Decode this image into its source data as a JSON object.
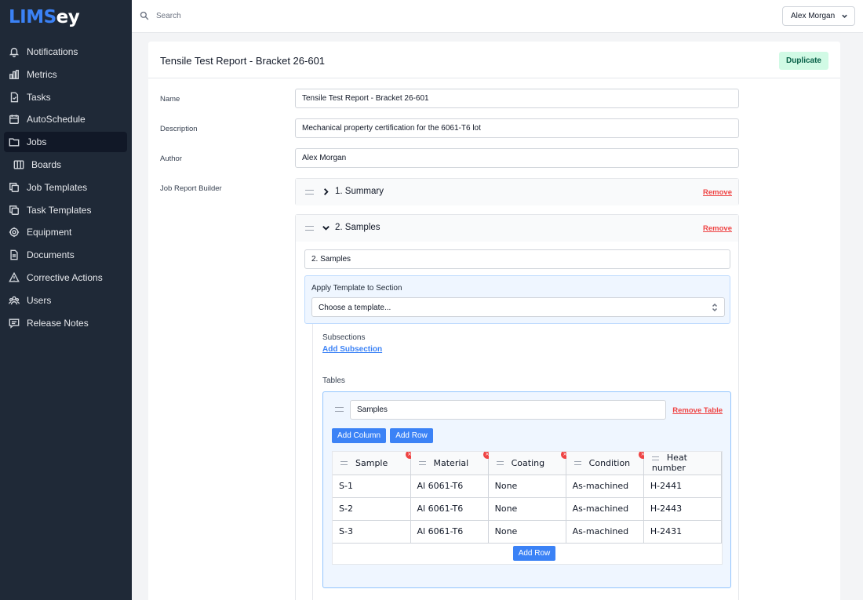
{
  "logo": {
    "part1": "LIMS",
    "part2": "ey"
  },
  "search": {
    "placeholder": "Search"
  },
  "user": {
    "name": "Alex Morgan"
  },
  "sidebar": {
    "items": [
      {
        "label": "Notifications",
        "icon": "bell-icon"
      },
      {
        "label": "Metrics",
        "icon": "bar-chart-icon"
      },
      {
        "label": "Tasks",
        "icon": "clipboard-check-icon"
      },
      {
        "label": "AutoSchedule",
        "icon": "calendar-icon"
      },
      {
        "label": "Jobs",
        "icon": "folder-icon"
      },
      {
        "label": "Boards",
        "icon": "columns-icon"
      },
      {
        "label": "Job Templates",
        "icon": "copy-icon"
      },
      {
        "label": "Task Templates",
        "icon": "copy-icon"
      },
      {
        "label": "Equipment",
        "icon": "gear-icon"
      },
      {
        "label": "Documents",
        "icon": "document-icon"
      },
      {
        "label": "Corrective Actions",
        "icon": "warning-icon"
      },
      {
        "label": "Users",
        "icon": "users-icon"
      },
      {
        "label": "Release Notes",
        "icon": "chat-icon"
      }
    ]
  },
  "header": {
    "title": "Tensile Test Report - Bracket 26-601",
    "duplicate_label": "Duplicate"
  },
  "form": {
    "name_label": "Name",
    "name_value": "Tensile Test Report - Bracket 26-601",
    "description_label": "Description",
    "description_value": "Mechanical property certification for the 6061-T6 lot",
    "author_label": "Author",
    "author_value": "Alex Morgan",
    "builder_label": "Job Report Builder"
  },
  "sections": [
    {
      "title": "1. Summary",
      "remove_label": "Remove"
    },
    {
      "title": "2. Samples",
      "remove_label": "Remove"
    }
  ],
  "samples_section": {
    "title_value": "2. Samples",
    "apply_label": "Apply Template to Section",
    "template_select": "Choose a template...",
    "subsections_label": "Subsections",
    "add_subsection": "Add Subsection",
    "tables_label": "Tables",
    "table": {
      "name_value": "Samples",
      "remove_table": "Remove Table",
      "add_column": "Add Column",
      "add_row": "Add Row",
      "delete_glyph": "×",
      "columns": [
        "Sample",
        "Material",
        "Coating",
        "Condition",
        "Heat number"
      ],
      "rows": [
        [
          "S-1",
          "Al 6061-T6",
          "None",
          "As-machined",
          "H-2441"
        ],
        [
          "S-2",
          "Al 6061-T6",
          "None",
          "As-machined",
          "H-2443"
        ],
        [
          "S-3",
          "Al 6061-T6",
          "None",
          "As-machined",
          "H-2431"
        ]
      ]
    }
  }
}
